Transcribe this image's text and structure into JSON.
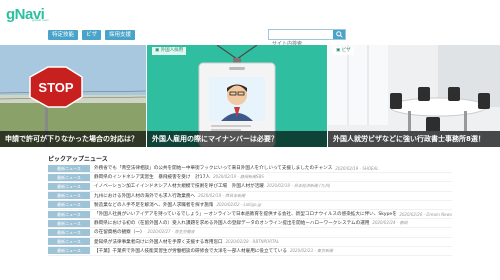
{
  "header": {
    "logo_text": "gNavi",
    "logo_sub": "global navi",
    "nav": [
      "特定技能",
      "ビザ",
      "採用支援"
    ],
    "search_placeholder": "サイト内検索"
  },
  "colors": {
    "brand": "#2fbfa0",
    "nav": "#4aa3c8",
    "tag": "#9fc3d6"
  },
  "carousel": {
    "slides": [
      {
        "tag": "",
        "caption": "申請で許可が下りなかった場合の対応は？"
      },
      {
        "tag": "外国人採用",
        "caption": "外国人雇用の際にマイナンバーは必要？"
      },
      {
        "tag": "ビザ",
        "caption": "外国人就労ビザなどに強い行政書士事務所8選！"
      }
    ]
  },
  "pickup": {
    "title": "ピックアップニュース",
    "items": [
      {
        "tag": "最新ニュース",
        "text": "外務省でも「青空法律相談」の公共を開始ー中華街フックにいって来日外国人を介しいって支援しましたのチャンス",
        "date": "2020/02/19 - SHOEAL"
      },
      {
        "tag": "最新ニュース",
        "text": "静岡県のインドネシア実習生　暴飛被害を受け　計17人",
        "date": "2020/02/19 - 静岡新聞SBS"
      },
      {
        "tag": "最新ニュース",
        "text": "イノベーション加工イインドネシア人材大規模で技術を呼び工場　外国人材が活躍",
        "date": "2020/02/18 - 日本経済新聞 (九州)"
      },
      {
        "tag": "最新ニュース",
        "text": "九州における外国人材の海外でも求人行政業務へ",
        "date": "2020/02/18 - 西日本新聞"
      },
      {
        "tag": "最新ニュース",
        "text": "製造業などの人手不足を解消へ、外国人求職者を探す施策",
        "date": "2020/02/02 - Lolligo.jp"
      },
      {
        "tag": "最新ニュース",
        "text": "「外国人社員がいいアイデアを持っているでしょう」ーオンラインで日本語教育を提供する会社、新型コロナウイルスの感染拡大に伴い、Skypeを活用したレッスンを一部無償提供",
        "date": "2020/02/26 - Dream News"
      },
      {
        "tag": "最新ニュース",
        "text": "静岡県における初の（在留外国人の）受入れ課題を求める外国人の登録データのオンライン提出を開始ーハローワークシステムの運用",
        "date": "2020/02/24 - 静岡"
      },
      {
        "tag": "最新ニュース",
        "text": "の在留資格の観察（一）",
        "date": "2020/02/27 - 厚生労働省"
      },
      {
        "tag": "最新ニュース",
        "text": "愛知県が法律事業者向けに外国人材を手厚く支援する専用窓口",
        "date": "2020/02/28 - RBTNPORTAL"
      },
      {
        "tag": "最新ニュース",
        "text": "【千葉】千葉県で外国人技能実習生が労働相談の研修会で大洋を一部人材雇用に役立てている",
        "date": "2020/02/23 - 東京新聞"
      }
    ]
  }
}
